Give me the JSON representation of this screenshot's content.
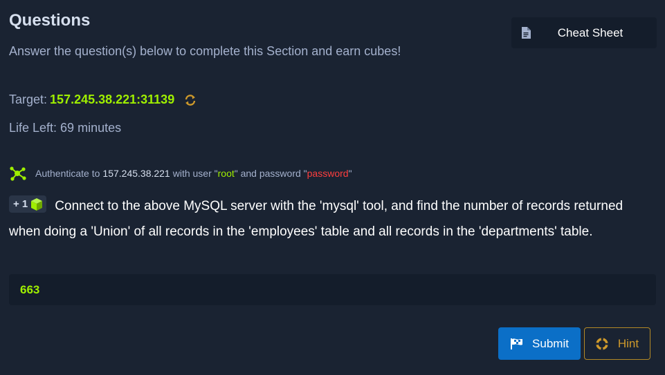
{
  "header": {
    "title": "Questions",
    "subtitle": "Answer the question(s) below to complete this Section and earn cubes!",
    "cheat_sheet_label": "Cheat Sheet"
  },
  "target": {
    "label": "Target:",
    "address": "157.245.38.221:31139"
  },
  "life": {
    "text": "Life Left: 69 minutes"
  },
  "auth": {
    "prefix": "Authenticate to",
    "host": "157.245.38.221",
    "user_text": "with user \"",
    "user": "root",
    "pass_text": "\" and password \"",
    "password": "password",
    "suffix": "\""
  },
  "question": {
    "reward": "+ 1",
    "text": "Connect to the above MySQL server with the 'mysql' tool, and find the number of records returned when doing a 'Union' of all records in the 'employees' table and all records in the 'departments' table.",
    "answer": "663"
  },
  "actions": {
    "submit_label": "Submit",
    "hint_label": "Hint"
  },
  "colors": {
    "background": "#1a2332",
    "accent_green": "#9fef00",
    "error_red": "#ff3e3e",
    "submit_blue": "#0b6fc7",
    "hint_gold": "#cf9a2b"
  },
  "icons": [
    "document-icon",
    "refresh-icon",
    "network-icon",
    "cube-icon",
    "flag-icon",
    "lifebuoy-icon"
  ]
}
